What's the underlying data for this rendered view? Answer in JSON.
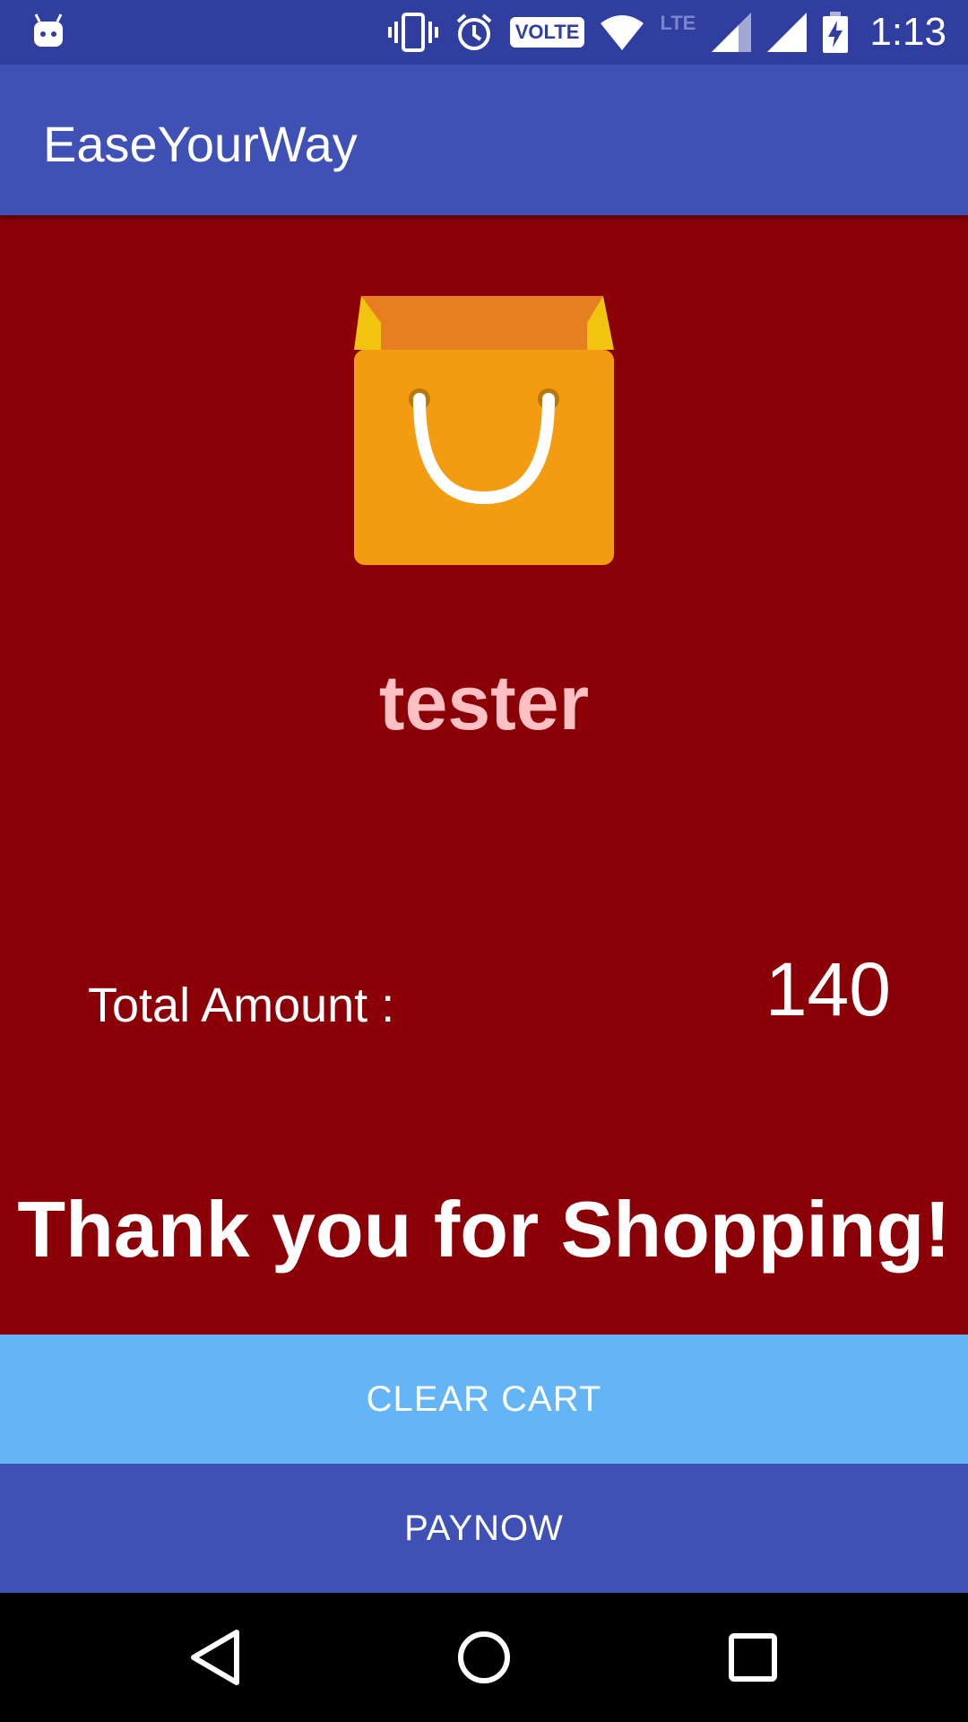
{
  "status_bar": {
    "time": "1:13",
    "volte_label": "VOLTE",
    "lte_label": "LTE",
    "icons": [
      "android-notification-icon",
      "vibrate-icon",
      "alarm-icon",
      "volte-icon",
      "wifi-icon",
      "lte-icon",
      "signal-icon",
      "signal-icon",
      "battery-charging-icon"
    ]
  },
  "app_bar": {
    "title": "EaseYourWay"
  },
  "main": {
    "image_icon": "shopping-bag-icon",
    "username": "tester",
    "total_label": "Total Amount :",
    "total_value": "140",
    "thanks_message": "Thank you for Shopping!"
  },
  "buttons": {
    "clear_cart": "CLEAR CART",
    "pay_now": "PAYNOW"
  },
  "nav_bar": {
    "icons": [
      "back-icon",
      "home-icon",
      "recents-icon"
    ]
  },
  "colors": {
    "status_bar": "#303f9f",
    "app_bar": "#3f51b5",
    "content_bg": "#8b0007",
    "username": "#ffc0c4",
    "clear_cart_bg": "#64b5f6",
    "pay_now_bg": "#3f51b5",
    "bag": "#f39c12"
  }
}
